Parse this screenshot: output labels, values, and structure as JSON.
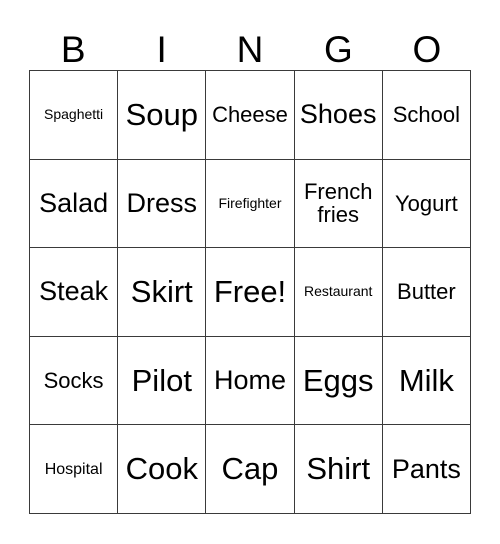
{
  "card": {
    "title": "BINGO",
    "columns": [
      "B",
      "I",
      "N",
      "G",
      "O"
    ],
    "free_space_label": "Free!",
    "colors": {
      "background": "#ffffff",
      "text": "#000000",
      "border": "#3a3a3a"
    },
    "grid_size": "5x5",
    "rows": [
      [
        {
          "text": "Spaghetti",
          "size": "xs"
        },
        {
          "text": "Soup",
          "size": "xl"
        },
        {
          "text": "Cheese",
          "size": "m"
        },
        {
          "text": "Shoes",
          "size": "l"
        },
        {
          "text": "School",
          "size": "m"
        }
      ],
      [
        {
          "text": "Salad",
          "size": "l"
        },
        {
          "text": "Dress",
          "size": "l"
        },
        {
          "text": "Firefighter",
          "size": "xs"
        },
        {
          "text": "French\nfries",
          "size": "m"
        },
        {
          "text": "Yogurt",
          "size": "m"
        }
      ],
      [
        {
          "text": "Steak",
          "size": "l"
        },
        {
          "text": "Skirt",
          "size": "xl"
        },
        {
          "text": "Free!",
          "size": "xl"
        },
        {
          "text": "Restaurant",
          "size": "xs"
        },
        {
          "text": "Butter",
          "size": "m"
        }
      ],
      [
        {
          "text": "Socks",
          "size": "m"
        },
        {
          "text": "Pilot",
          "size": "xl"
        },
        {
          "text": "Home",
          "size": "l"
        },
        {
          "text": "Eggs",
          "size": "xl"
        },
        {
          "text": "Milk",
          "size": "xl"
        }
      ],
      [
        {
          "text": "Hospital",
          "size": "s"
        },
        {
          "text": "Cook",
          "size": "xl"
        },
        {
          "text": "Cap",
          "size": "xl"
        },
        {
          "text": "Shirt",
          "size": "xl"
        },
        {
          "text": "Pants",
          "size": "l"
        }
      ]
    ]
  }
}
